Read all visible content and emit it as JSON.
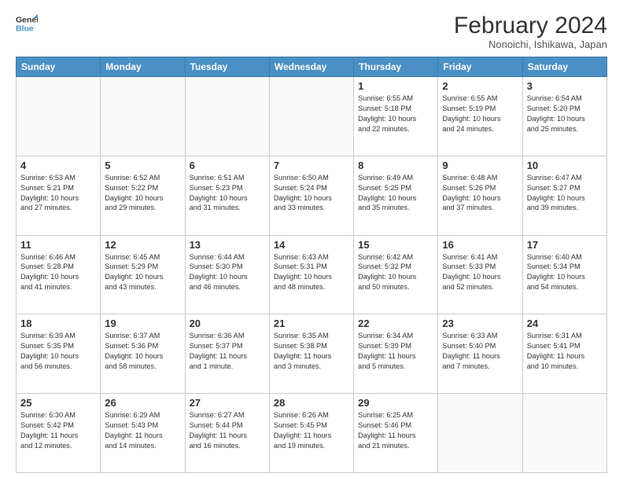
{
  "logo": {
    "line1": "General",
    "line2": "Blue"
  },
  "title": "February 2024",
  "location": "Nonoichi, Ishikawa, Japan",
  "days_of_week": [
    "Sunday",
    "Monday",
    "Tuesday",
    "Wednesday",
    "Thursday",
    "Friday",
    "Saturday"
  ],
  "weeks": [
    [
      {
        "day": "",
        "info": ""
      },
      {
        "day": "",
        "info": ""
      },
      {
        "day": "",
        "info": ""
      },
      {
        "day": "",
        "info": ""
      },
      {
        "day": "1",
        "info": "Sunrise: 6:55 AM\nSunset: 5:18 PM\nDaylight: 10 hours\nand 22 minutes."
      },
      {
        "day": "2",
        "info": "Sunrise: 6:55 AM\nSunset: 5:19 PM\nDaylight: 10 hours\nand 24 minutes."
      },
      {
        "day": "3",
        "info": "Sunrise: 6:54 AM\nSunset: 5:20 PM\nDaylight: 10 hours\nand 25 minutes."
      }
    ],
    [
      {
        "day": "4",
        "info": "Sunrise: 6:53 AM\nSunset: 5:21 PM\nDaylight: 10 hours\nand 27 minutes."
      },
      {
        "day": "5",
        "info": "Sunrise: 6:52 AM\nSunset: 5:22 PM\nDaylight: 10 hours\nand 29 minutes."
      },
      {
        "day": "6",
        "info": "Sunrise: 6:51 AM\nSunset: 5:23 PM\nDaylight: 10 hours\nand 31 minutes."
      },
      {
        "day": "7",
        "info": "Sunrise: 6:50 AM\nSunset: 5:24 PM\nDaylight: 10 hours\nand 33 minutes."
      },
      {
        "day": "8",
        "info": "Sunrise: 6:49 AM\nSunset: 5:25 PM\nDaylight: 10 hours\nand 35 minutes."
      },
      {
        "day": "9",
        "info": "Sunrise: 6:48 AM\nSunset: 5:26 PM\nDaylight: 10 hours\nand 37 minutes."
      },
      {
        "day": "10",
        "info": "Sunrise: 6:47 AM\nSunset: 5:27 PM\nDaylight: 10 hours\nand 39 minutes."
      }
    ],
    [
      {
        "day": "11",
        "info": "Sunrise: 6:46 AM\nSunset: 5:28 PM\nDaylight: 10 hours\nand 41 minutes."
      },
      {
        "day": "12",
        "info": "Sunrise: 6:45 AM\nSunset: 5:29 PM\nDaylight: 10 hours\nand 43 minutes."
      },
      {
        "day": "13",
        "info": "Sunrise: 6:44 AM\nSunset: 5:30 PM\nDaylight: 10 hours\nand 46 minutes."
      },
      {
        "day": "14",
        "info": "Sunrise: 6:43 AM\nSunset: 5:31 PM\nDaylight: 10 hours\nand 48 minutes."
      },
      {
        "day": "15",
        "info": "Sunrise: 6:42 AM\nSunset: 5:32 PM\nDaylight: 10 hours\nand 50 minutes."
      },
      {
        "day": "16",
        "info": "Sunrise: 6:41 AM\nSunset: 5:33 PM\nDaylight: 10 hours\nand 52 minutes."
      },
      {
        "day": "17",
        "info": "Sunrise: 6:40 AM\nSunset: 5:34 PM\nDaylight: 10 hours\nand 54 minutes."
      }
    ],
    [
      {
        "day": "18",
        "info": "Sunrise: 6:39 AM\nSunset: 5:35 PM\nDaylight: 10 hours\nand 56 minutes."
      },
      {
        "day": "19",
        "info": "Sunrise: 6:37 AM\nSunset: 5:36 PM\nDaylight: 10 hours\nand 58 minutes."
      },
      {
        "day": "20",
        "info": "Sunrise: 6:36 AM\nSunset: 5:37 PM\nDaylight: 11 hours\nand 1 minute."
      },
      {
        "day": "21",
        "info": "Sunrise: 6:35 AM\nSunset: 5:38 PM\nDaylight: 11 hours\nand 3 minutes."
      },
      {
        "day": "22",
        "info": "Sunrise: 6:34 AM\nSunset: 5:39 PM\nDaylight: 11 hours\nand 5 minutes."
      },
      {
        "day": "23",
        "info": "Sunrise: 6:33 AM\nSunset: 5:40 PM\nDaylight: 11 hours\nand 7 minutes."
      },
      {
        "day": "24",
        "info": "Sunrise: 6:31 AM\nSunset: 5:41 PM\nDaylight: 11 hours\nand 10 minutes."
      }
    ],
    [
      {
        "day": "25",
        "info": "Sunrise: 6:30 AM\nSunset: 5:42 PM\nDaylight: 11 hours\nand 12 minutes."
      },
      {
        "day": "26",
        "info": "Sunrise: 6:29 AM\nSunset: 5:43 PM\nDaylight: 11 hours\nand 14 minutes."
      },
      {
        "day": "27",
        "info": "Sunrise: 6:27 AM\nSunset: 5:44 PM\nDaylight: 11 hours\nand 16 minutes."
      },
      {
        "day": "28",
        "info": "Sunrise: 6:26 AM\nSunset: 5:45 PM\nDaylight: 11 hours\nand 19 minutes."
      },
      {
        "day": "29",
        "info": "Sunrise: 6:25 AM\nSunset: 5:46 PM\nDaylight: 11 hours\nand 21 minutes."
      },
      {
        "day": "",
        "info": ""
      },
      {
        "day": "",
        "info": ""
      }
    ]
  ]
}
